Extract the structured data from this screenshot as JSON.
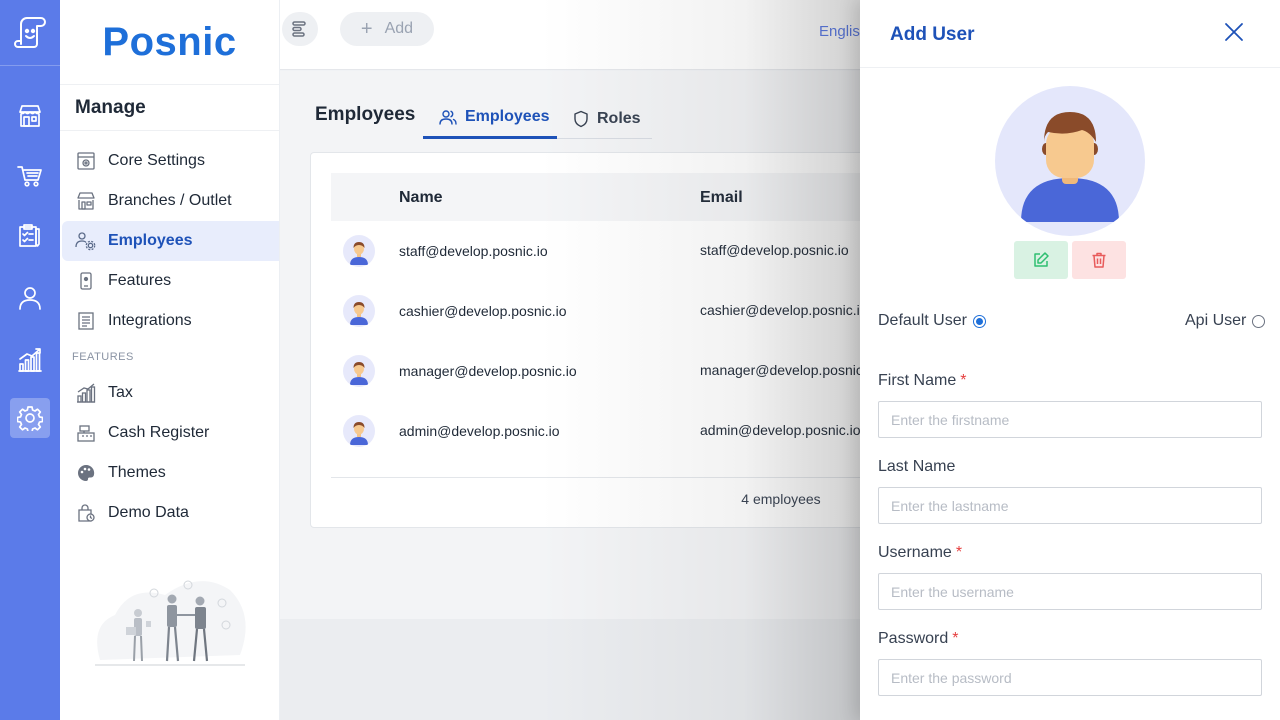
{
  "brand": {
    "name": "Posnic"
  },
  "rail": {
    "items": [
      {
        "icon": "store-icon"
      },
      {
        "icon": "cart-icon"
      },
      {
        "icon": "clipboard-icon"
      },
      {
        "icon": "user-icon"
      },
      {
        "icon": "chart-icon"
      },
      {
        "icon": "gear-icon",
        "active": true
      }
    ]
  },
  "menu": {
    "title": "Manage",
    "items": [
      {
        "label": "Core Settings",
        "icon": "settings-doc-icon"
      },
      {
        "label": "Branches / Outlet",
        "icon": "store-icon"
      },
      {
        "label": "Employees",
        "icon": "employees-gear-icon",
        "active": true
      },
      {
        "label": "Features",
        "icon": "mobile-icon"
      },
      {
        "label": "Integrations",
        "icon": "document-list-icon"
      }
    ],
    "section": "FEATURES",
    "feature_items": [
      {
        "label": "Tax",
        "icon": "chart-icon"
      },
      {
        "label": "Cash Register",
        "icon": "cash-register-icon"
      },
      {
        "label": "Themes",
        "icon": "palette-icon"
      },
      {
        "label": "Demo Data",
        "icon": "demo-bag-icon"
      }
    ]
  },
  "header": {
    "add_label": "Add",
    "language": "English"
  },
  "page": {
    "title": "Employees",
    "tabs": [
      {
        "label": "Employees",
        "icon": "users-icon",
        "active": true
      },
      {
        "label": "Roles",
        "icon": "shield-icon"
      }
    ]
  },
  "table": {
    "columns": [
      "Name",
      "Email"
    ],
    "rows": [
      {
        "name": "staff@develop.posnic.io",
        "email": "staff@develop.posnic.io"
      },
      {
        "name": "cashier@develop.posnic.io",
        "email": "cashier@develop.posnic.io"
      },
      {
        "name": "manager@develop.posnic.io",
        "email": "manager@develop.posnic.io"
      },
      {
        "name": "admin@develop.posnic.io",
        "email": "admin@develop.posnic.io"
      }
    ],
    "footer": "4 employees"
  },
  "drawer": {
    "title": "Add User",
    "user_types": [
      {
        "label": "Default User",
        "checked": true
      },
      {
        "label": "Api User",
        "checked": false
      }
    ],
    "fields": [
      {
        "label": "First Name",
        "required": "*",
        "placeholder": "Enter the firstname",
        "value": ""
      },
      {
        "label": "Last Name",
        "required": "",
        "placeholder": "Enter the lastname",
        "value": ""
      },
      {
        "label": "Username",
        "required": "*",
        "placeholder": "Enter the username",
        "value": ""
      },
      {
        "label": "Password",
        "required": "*",
        "placeholder": "Enter the password",
        "value": ""
      }
    ]
  },
  "colors": {
    "rail": "#5b7be9",
    "brand": "#1e6fd9",
    "accent": "#1e52b8",
    "edit": "#2fbf71",
    "delete": "#e85b5b"
  }
}
